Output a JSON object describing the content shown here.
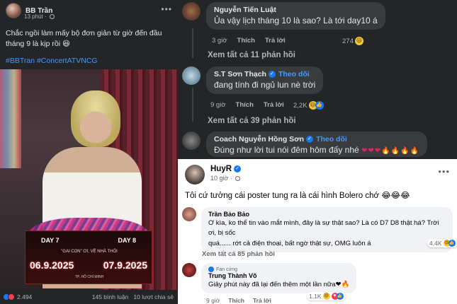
{
  "left_post": {
    "author": "BB Trần",
    "time": "13 phút",
    "text": "Chắc ngồi làm mấy bộ đơn giản từ giờ đến đầu tháng 9 là kịp rồi 😆",
    "hashtags": "#BBTran #ConcertATVNCG",
    "poster": {
      "day_left": "DAY 7",
      "day_right": "DAY 8",
      "subtitle": "\"GAI CON\" ƠI, VỀ NHÀ THÔI",
      "date_left": "06.9.2025",
      "date_right": "07.9.2025",
      "city": "TP. HỒ CHÍ MINH"
    },
    "reactions": "2.494",
    "comments": "145 bình luận",
    "shares": "10 lượt chia sẻ"
  },
  "dark_comments": [
    {
      "name": "Nguyễn Tiến Luật",
      "text": "Ủa vậy lịch tháng 10 là sao? Là tới day10 á",
      "time": "3 giờ",
      "like": "Thích",
      "reply": "Trả lời",
      "count": "274",
      "view_more": "Xem tất cả 11 phản hồi"
    },
    {
      "name": "S.T Sơn Thạch",
      "follow": "Theo dõi",
      "text": "đang tính đi ngủ lun nè trời",
      "time": "9 giờ",
      "like": "Thích",
      "reply": "Trả lời",
      "count": "2,2K",
      "view_more": "Xem tất cả 39 phản hồi"
    },
    {
      "name": "Coach Nguyễn Hồng Sơn",
      "follow": "Theo dõi",
      "text": "Đúng như lời tui nói đêm hôm đấy nhé",
      "hearts": "❤❤❤🔥🔥🔥🔥"
    }
  ],
  "light_post": {
    "author": "HuyR",
    "time": "10 giờ",
    "text": "Tôi cứ tưởng cái poster tung ra là cái hình Bolero chớ 😂😂😂",
    "comments": [
      {
        "name": "Trần Bảo Bảo",
        "text1": "Ơ kìa, ko thể tin vào mắt mình, đây là sự thật sao? Là có D7 D8 thật há? Trời ơi, bị sốc",
        "text2": "quá...... rớt cả điện thoại, bất ngờ thật sự, OMG luôn á",
        "count": "4,4K",
        "view_more": "Xem tất cả 85 phản hồi"
      },
      {
        "badge": "Fan cứng",
        "name": "Trung Thành Võ",
        "text1": "Giây phút này đã lại đến thêm một lần nữa❤🔥",
        "time": "9 giờ",
        "like": "Thích",
        "reply": "Trả lời",
        "count": "1,1K"
      }
    ]
  },
  "colors": {
    "dark_bg": "#242526",
    "bubble_dark": "#3a3b3c",
    "link_blue": "#4599ff",
    "fb_blue": "#1877f2"
  }
}
